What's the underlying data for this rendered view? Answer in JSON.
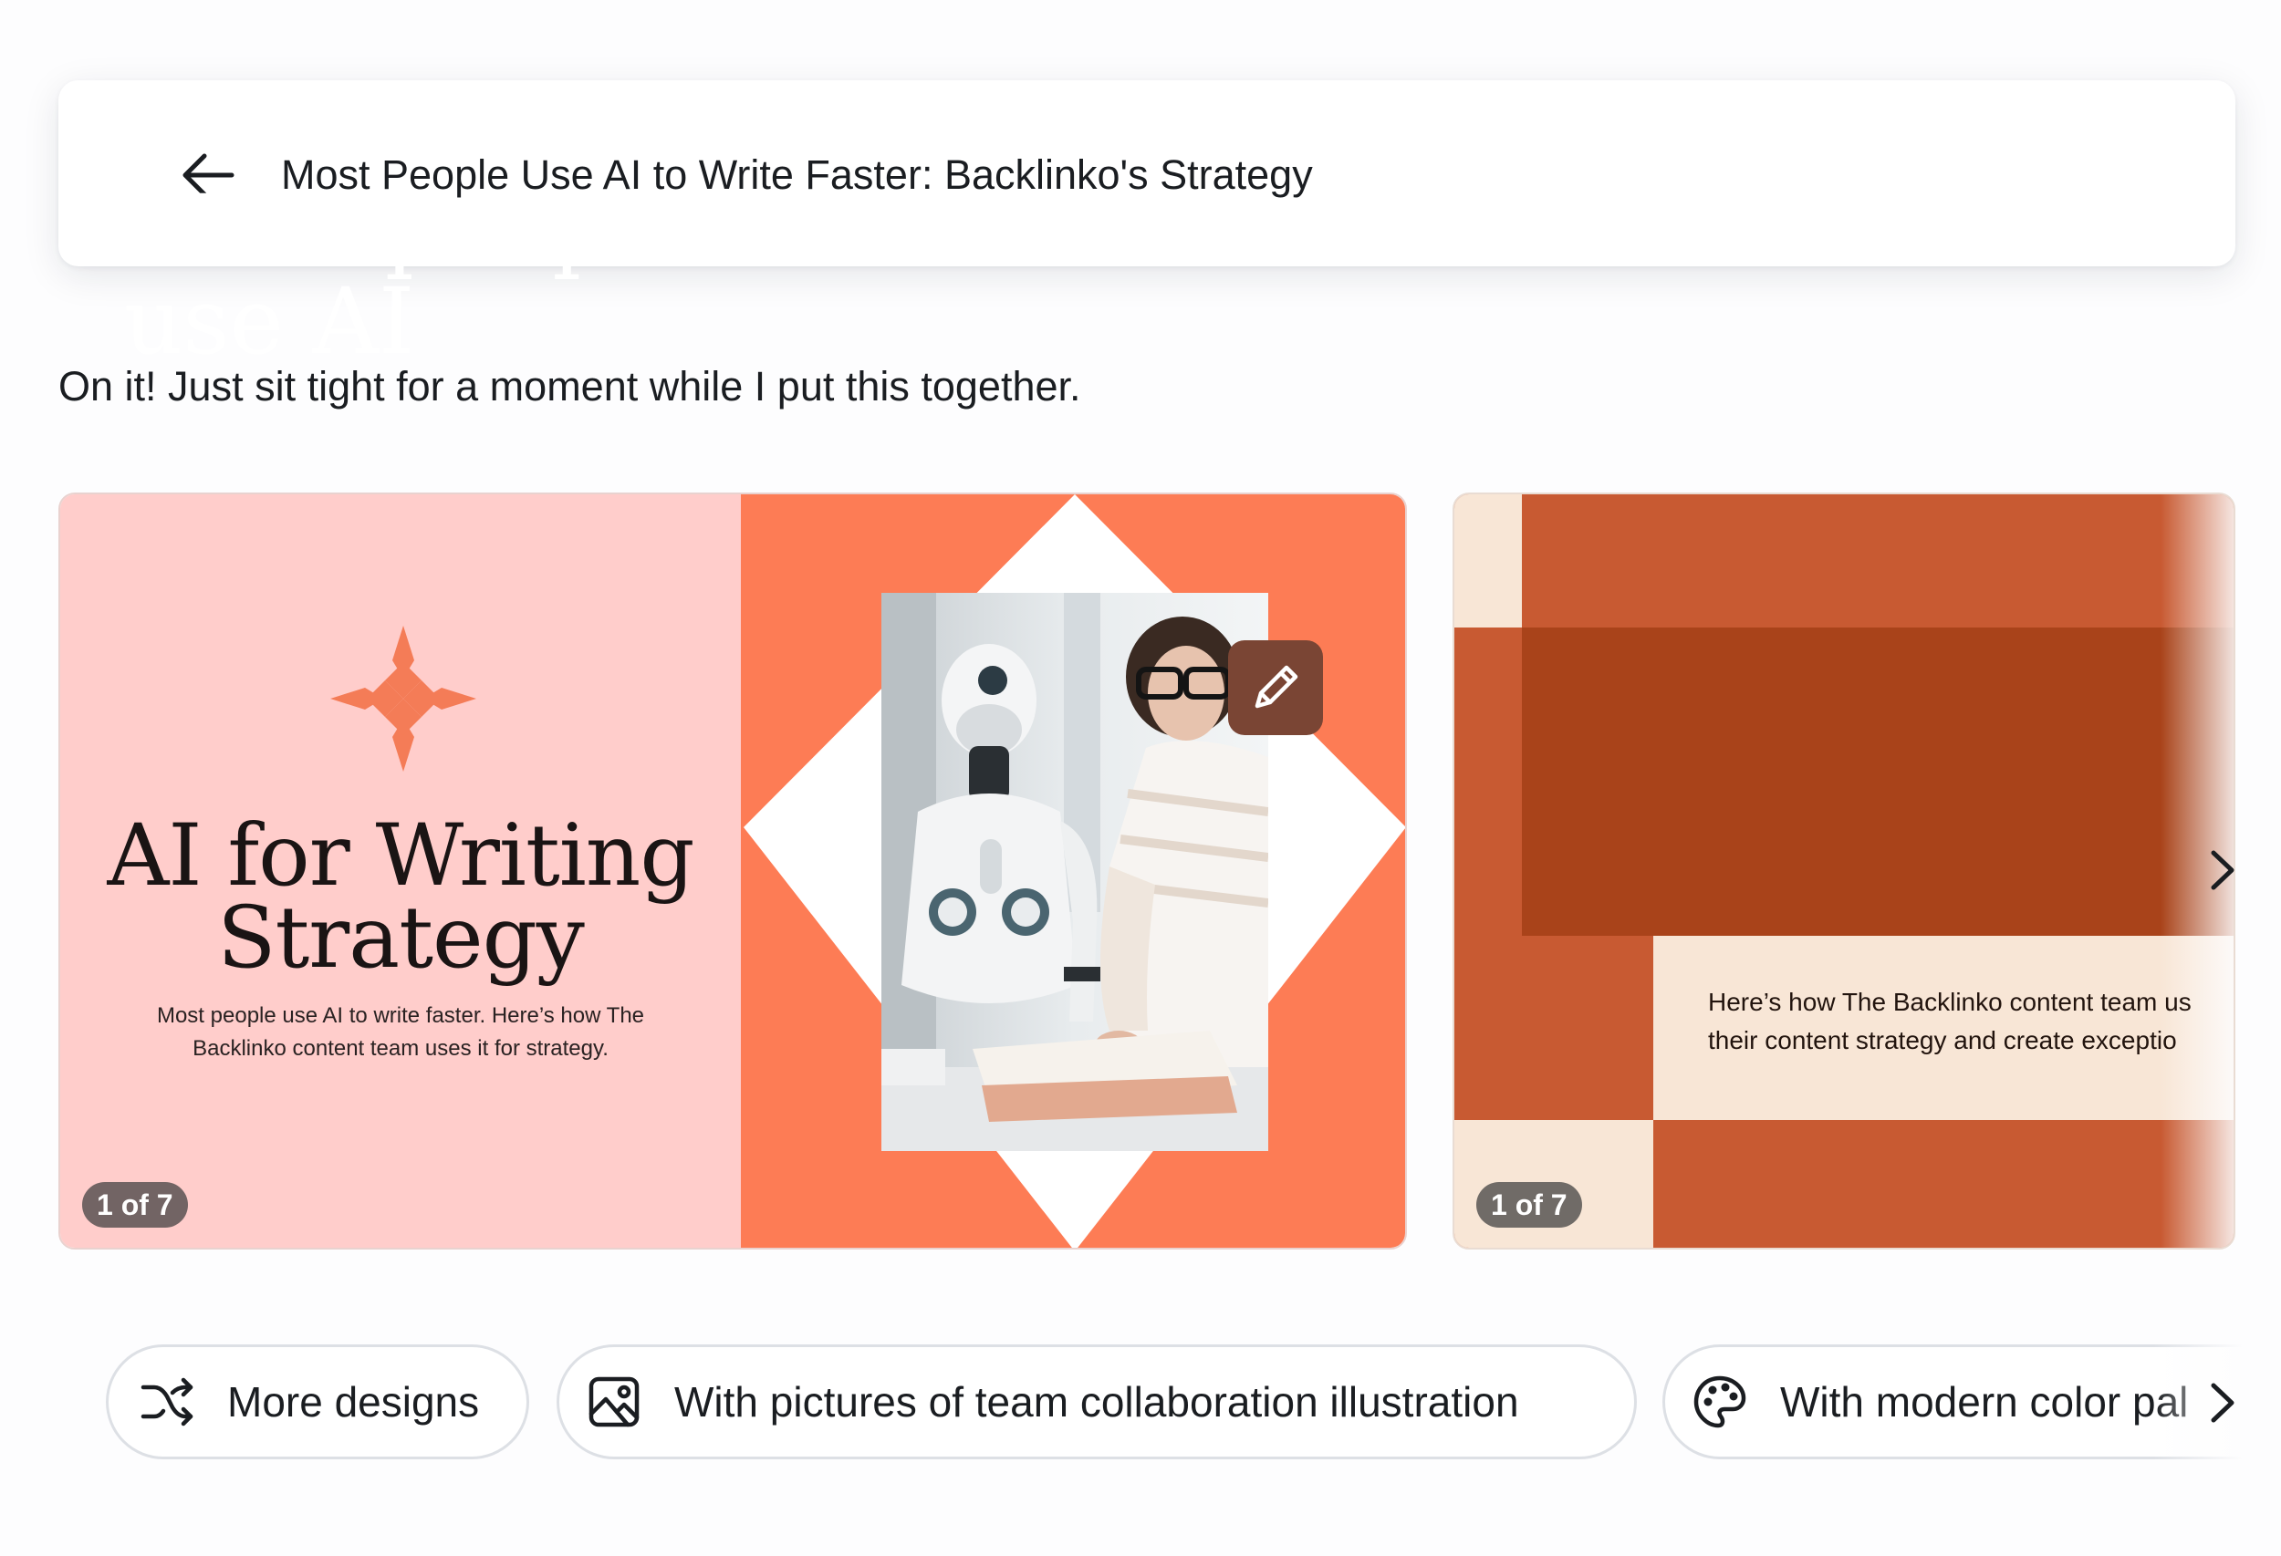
{
  "header": {
    "back_icon": "arrow-left-icon",
    "title": "Most People Use AI to Write Faster: Backlinko's Strategy"
  },
  "status_message": "On it! Just sit tight for a moment while I put this together.",
  "designs": [
    {
      "title_line1": "AI for Writing",
      "title_line2": "Strategy",
      "subtitle_line1": "Most people use AI to write faster. Here’s how The",
      "subtitle_line2": "Backlinko content team uses it for strategy.",
      "page_badge": "1 of 7",
      "edit_icon": "pencil-icon",
      "colors": {
        "left_bg": "#ffcdcb",
        "right_bg": "#fd7c55",
        "accent": "#f47c57"
      }
    },
    {
      "title_line1": "Most people",
      "title_line2": "use AI",
      "text_line1": "Here’s how The Backlinko content team us",
      "text_line2": "their content strategy and create exceptio",
      "page_badge": "1 of 7",
      "colors": {
        "bg": "#c85a32",
        "title_box": "#a9431a",
        "cream": "#f8e6d6"
      }
    }
  ],
  "suggestions": [
    {
      "icon": "shuffle-icon",
      "label": "More designs"
    },
    {
      "icon": "image-icon",
      "label": "With pictures of team collaboration illustration"
    },
    {
      "icon": "palette-icon",
      "label": "With modern color pal"
    }
  ],
  "nav": {
    "next_icon": "chevron-right-icon"
  }
}
